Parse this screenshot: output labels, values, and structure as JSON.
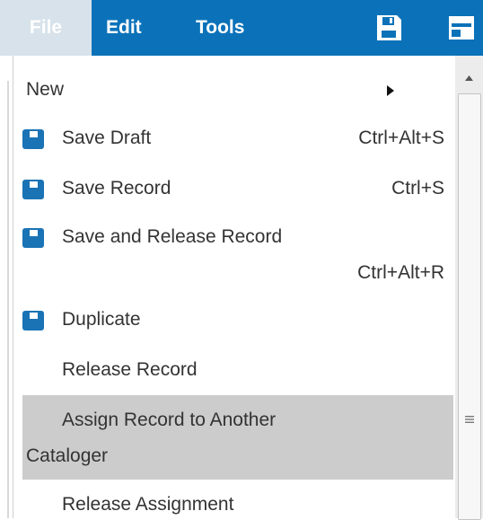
{
  "menubar": {
    "tabs": [
      {
        "label": "File",
        "active": true
      },
      {
        "label": "Edit"
      },
      {
        "label": "Tools"
      }
    ],
    "icons": [
      "save-icon",
      "panel-icon"
    ]
  },
  "menu": {
    "items": [
      {
        "label": "New",
        "has_submenu": true
      },
      {
        "label": "Save Draft",
        "shortcut": "Ctrl+Alt+S",
        "icon": "save-icon"
      },
      {
        "label": "Save Record",
        "shortcut": "Ctrl+S",
        "icon": "save-icon"
      },
      {
        "label": "Save and Release Record",
        "shortcut": "Ctrl+Alt+R",
        "icon": "save-icon"
      },
      {
        "label": "Duplicate",
        "icon": "save-icon"
      },
      {
        "label": "Release Record"
      },
      {
        "label_line1": "Assign Record to Another",
        "label_line2": "Cataloger",
        "highlighted": true
      },
      {
        "label": "Release Assignment"
      }
    ]
  },
  "colors": {
    "menubar": "#0b72b9",
    "active_tab": "#d7e2ea",
    "highlight": "#cccccc",
    "icon": "#1a73b5"
  }
}
